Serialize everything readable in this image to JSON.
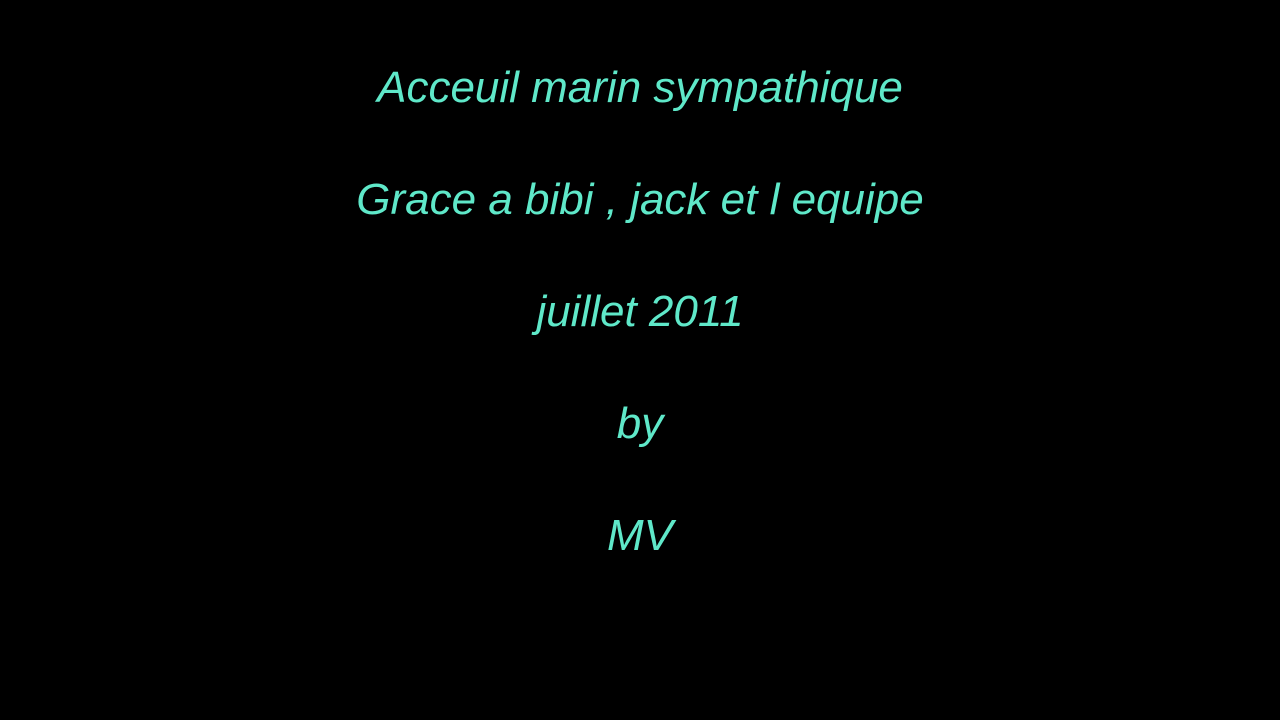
{
  "colors": {
    "background": "#000000",
    "text": "#5fe8c9"
  },
  "lines": [
    "Acceuil marin sympathique",
    "Grace a bibi , jack et l equipe",
    "juillet 2011",
    "by",
    "MV"
  ]
}
